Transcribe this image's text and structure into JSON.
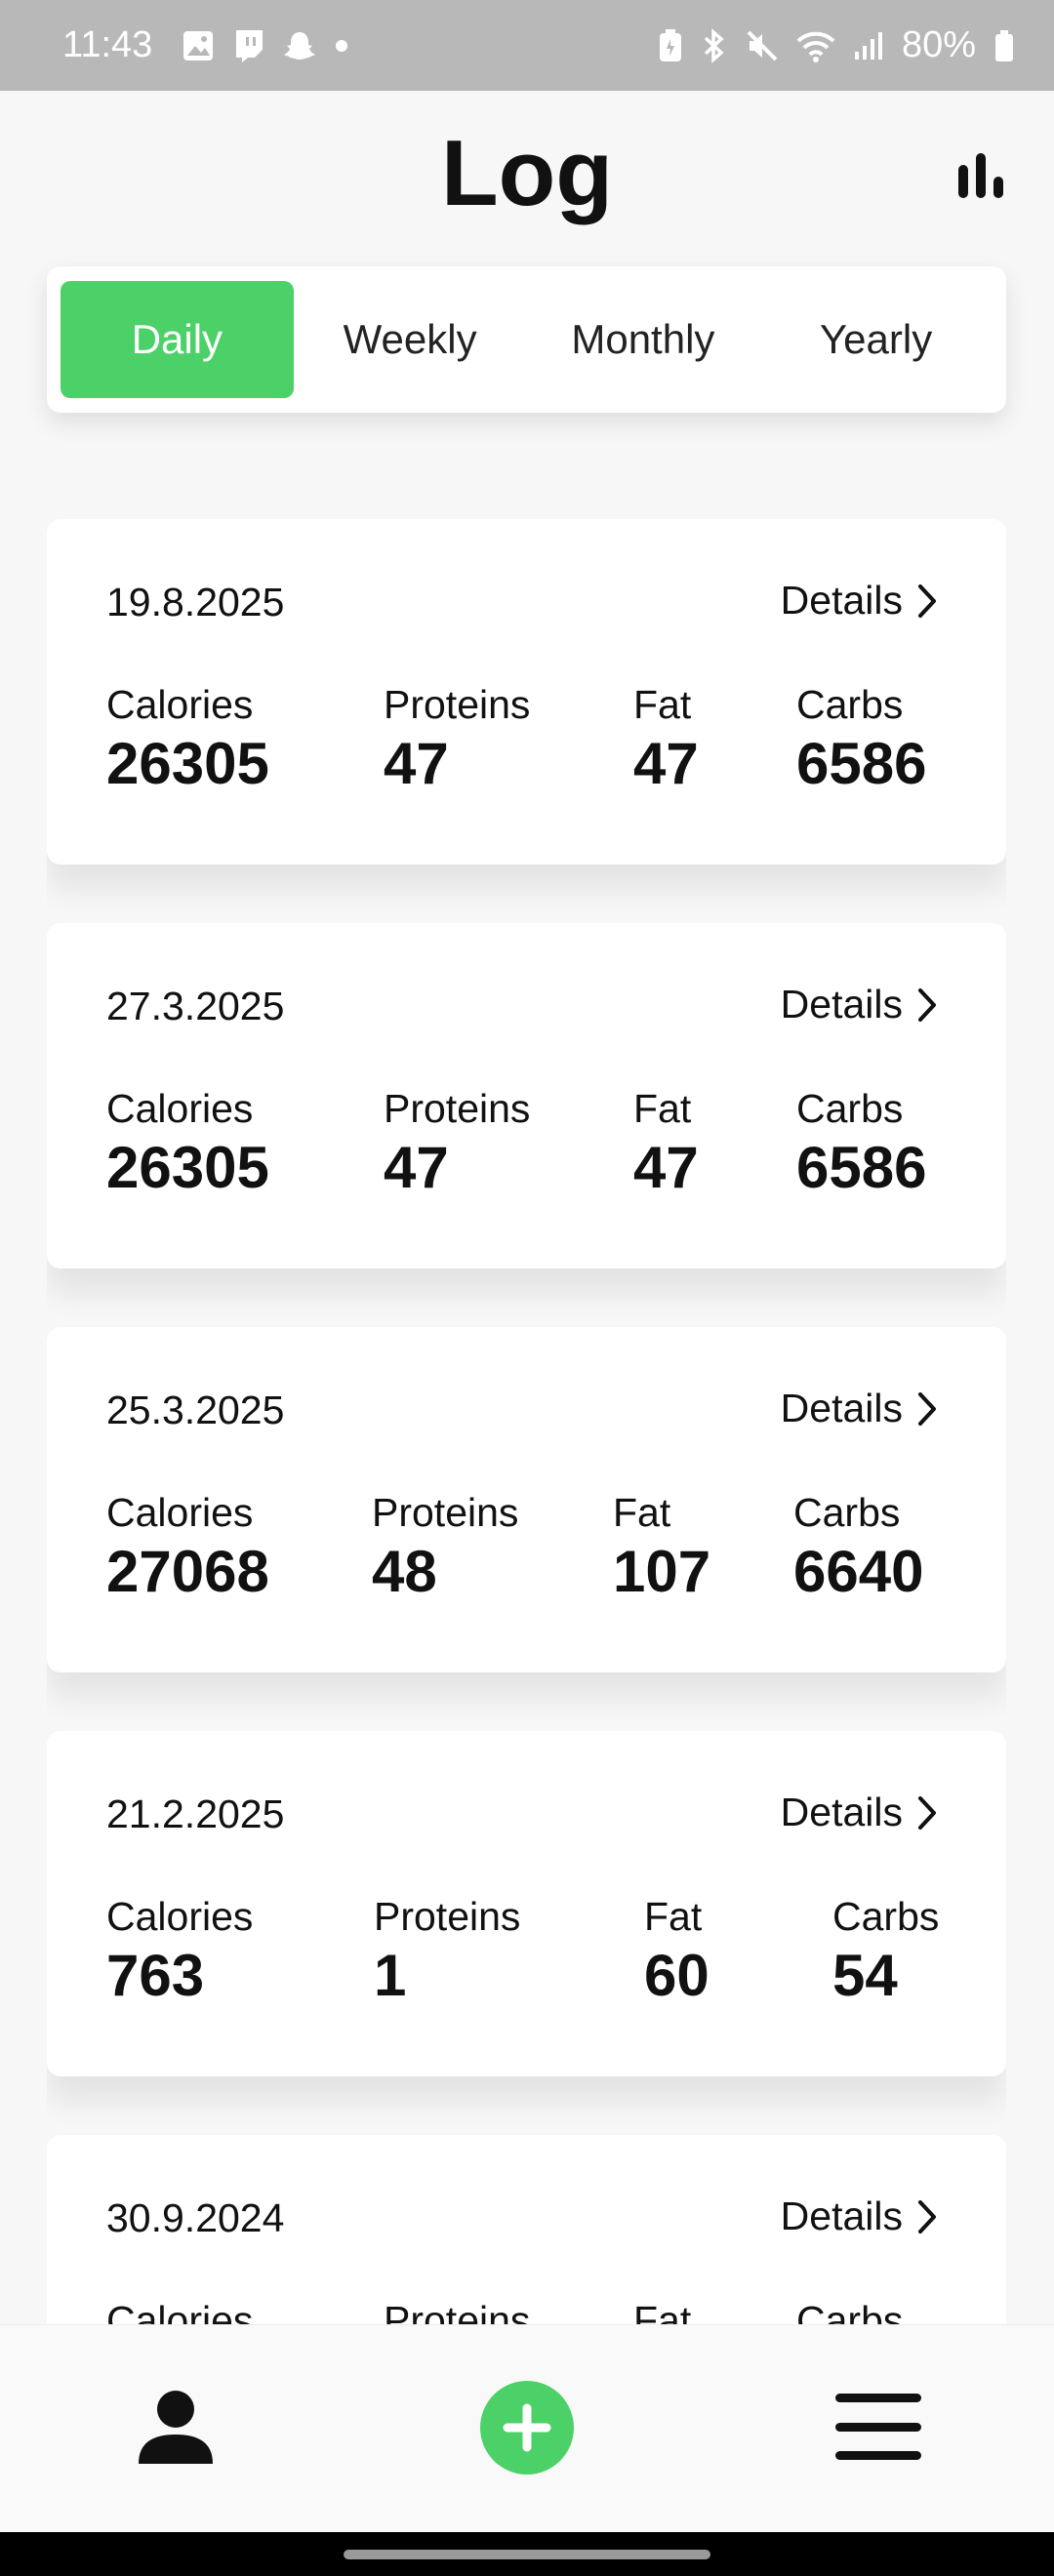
{
  "status_bar": {
    "time": "11:43",
    "battery": "80%",
    "left_icons": [
      "image-icon",
      "twitch-icon",
      "snapchat-icon",
      "dot-icon"
    ],
    "right_icons": [
      "battery-saver-icon",
      "bluetooth-icon",
      "mute-icon",
      "wifi-icon",
      "signal-icon",
      "battery-icon"
    ]
  },
  "header": {
    "title": "Log",
    "stats_icon": "bar-chart-icon"
  },
  "tabs": [
    {
      "label": "Daily",
      "active": true
    },
    {
      "label": "Weekly",
      "active": false
    },
    {
      "label": "Monthly",
      "active": false
    },
    {
      "label": "Yearly",
      "active": false
    }
  ],
  "labels": {
    "details": "Details",
    "calories": "Calories",
    "proteins": "Proteins",
    "fat": "Fat",
    "carbs": "Carbs"
  },
  "entries": [
    {
      "date": "19.8.2025",
      "calories": "26305",
      "proteins": "47",
      "fat": "47",
      "carbs": "6586"
    },
    {
      "date": "27.3.2025",
      "calories": "26305",
      "proteins": "47",
      "fat": "47",
      "carbs": "6586"
    },
    {
      "date": "25.3.2025",
      "calories": "27068",
      "proteins": "48",
      "fat": "107",
      "carbs": "6640"
    },
    {
      "date": "21.2.2025",
      "calories": "763",
      "proteins": "1",
      "fat": "60",
      "carbs": "54"
    },
    {
      "date": "30.9.2024",
      "calories": "",
      "proteins": "",
      "fat": "",
      "carbs": ""
    }
  ],
  "bottom_nav": {
    "items": [
      "profile-icon",
      "add-icon",
      "menu-icon"
    ]
  },
  "colors": {
    "accent": "#4cd168",
    "status_bar": "#b8b8b8",
    "background": "#f7f7f7"
  }
}
